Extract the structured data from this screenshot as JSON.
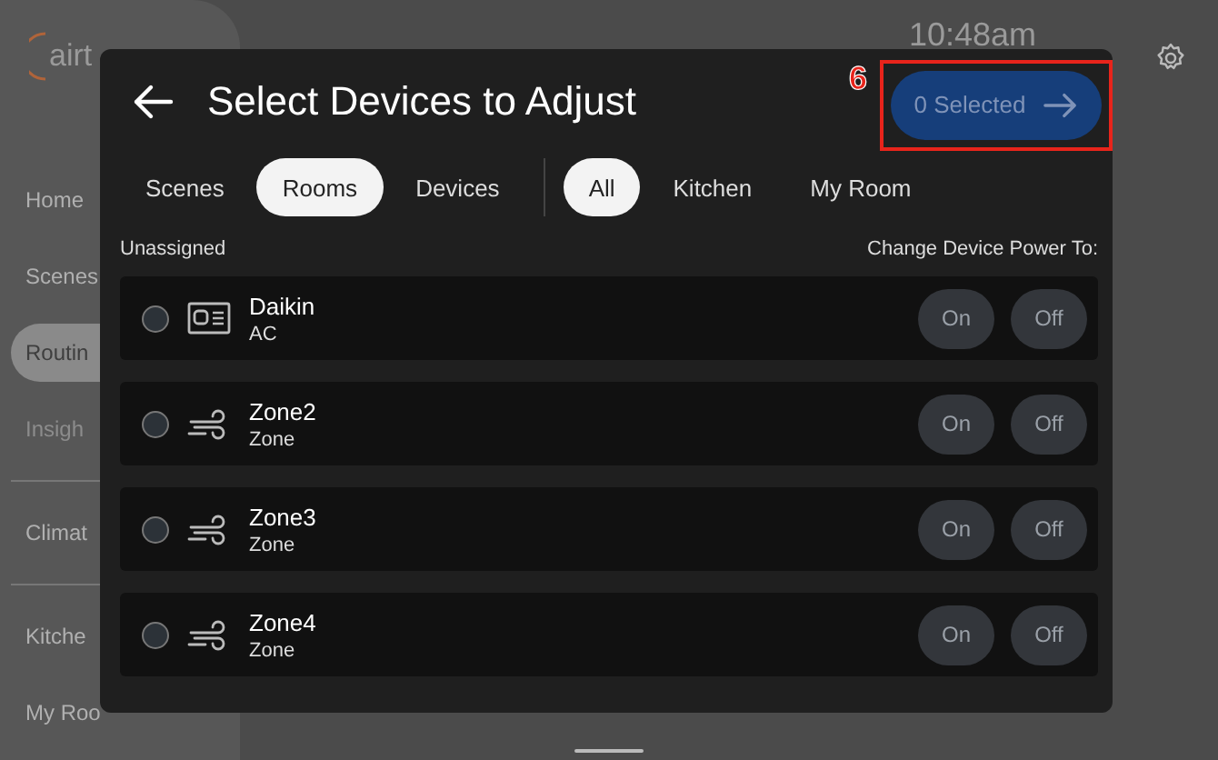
{
  "sidebar": {
    "logo": "airt",
    "items": [
      {
        "label": "Home",
        "selected": false
      },
      {
        "label": "Scenes",
        "selected": false
      },
      {
        "label": "Routin",
        "selected": true
      },
      {
        "label": "Insigh",
        "selected": false
      },
      {
        "label": "Climat",
        "selected": false
      },
      {
        "label": "Kitche",
        "selected": false
      },
      {
        "label": "My Roo",
        "selected": false
      }
    ]
  },
  "clock": "10:48am",
  "dialog": {
    "title": "Select Devices to Adjust",
    "selected_button": "0 Selected",
    "annotation": "6",
    "group_tabs": [
      {
        "label": "Scenes",
        "selected": false
      },
      {
        "label": "Rooms",
        "selected": true
      },
      {
        "label": "Devices",
        "selected": false
      }
    ],
    "room_tabs": [
      {
        "label": "All",
        "selected": true
      },
      {
        "label": "Kitchen",
        "selected": false
      },
      {
        "label": "My Room",
        "selected": false
      }
    ],
    "section": "Unassigned",
    "power_label": "Change Device Power To:",
    "devices": [
      {
        "name": "Daikin",
        "type": "AC",
        "kind": "ac",
        "selected": false,
        "on_label": "On",
        "off_label": "Off"
      },
      {
        "name": "Zone2",
        "type": "Zone",
        "kind": "zone",
        "selected": false,
        "on_label": "On",
        "off_label": "Off"
      },
      {
        "name": "Zone3",
        "type": "Zone",
        "kind": "zone",
        "selected": false,
        "on_label": "On",
        "off_label": "Off"
      },
      {
        "name": "Zone4",
        "type": "Zone",
        "kind": "zone",
        "selected": false,
        "on_label": "On",
        "off_label": "Off"
      }
    ]
  }
}
